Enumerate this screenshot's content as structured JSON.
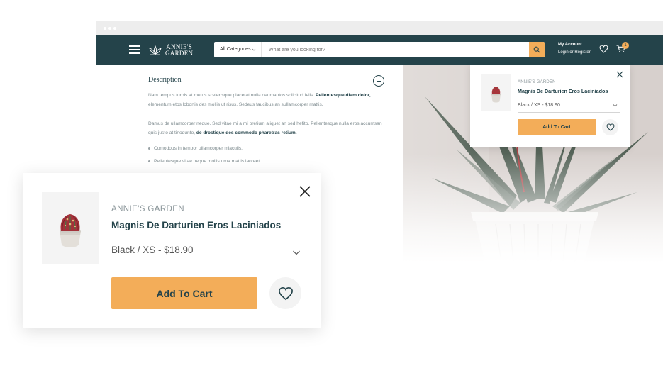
{
  "header": {
    "logo_line1": "ANNIE'S",
    "logo_line2": "GARDEN",
    "category_label": "All Categories",
    "search_placeholder": "What are you looking for?",
    "account_title": "My Account",
    "account_sub": "Login or Register",
    "cart_count": "1"
  },
  "description": {
    "title": "Description",
    "p1_text": "Nam tempus turpis at metus scelerisque placerat nulla deumantos solicitud felis.",
    "p1_bold": "Pellentesque diam dolor,",
    "p1_text2": "elementum etos lobortis des mollis ut risus. Sedeus faucibus an sullamcorper mattis.",
    "p2_text": "Damus de ullamcorper neque. Sed vitae mi a mi pretium aliquet an sed hefito. Pellentesque nulla eros accumsan quis justo at tinodunto,",
    "p2_bold": "de drostique des commodo pharetras retium.",
    "bullet1": "Comodous in tempor ullamcorper miaculis.",
    "bullet2": "Pellentesque vitae neque mollis urna mattis laoreet."
  },
  "mini_popup": {
    "brand": "ANNIE'S GARDEN",
    "product_title": "Magnis De Darturien Eros Laciniados",
    "variant": "Black / XS - $18.90",
    "add_to_cart": "Add To Cart"
  },
  "big_popup": {
    "brand": "ANNIE'S GARDEN",
    "product_title": "Magnis De Darturien Eros Laciniados",
    "variant": "Black / XS - $18.90",
    "add_to_cart": "Add To Cart"
  },
  "colors": {
    "navbar": "#24434a",
    "accent": "#f3ad59",
    "text_dark": "#24434a",
    "text_muted": "#8a9599"
  },
  "icons": [
    "menu-icon",
    "logo-lotus-icon",
    "chevron-down-icon",
    "search-icon",
    "heart-icon",
    "cart-icon",
    "close-icon",
    "minus-icon"
  ]
}
